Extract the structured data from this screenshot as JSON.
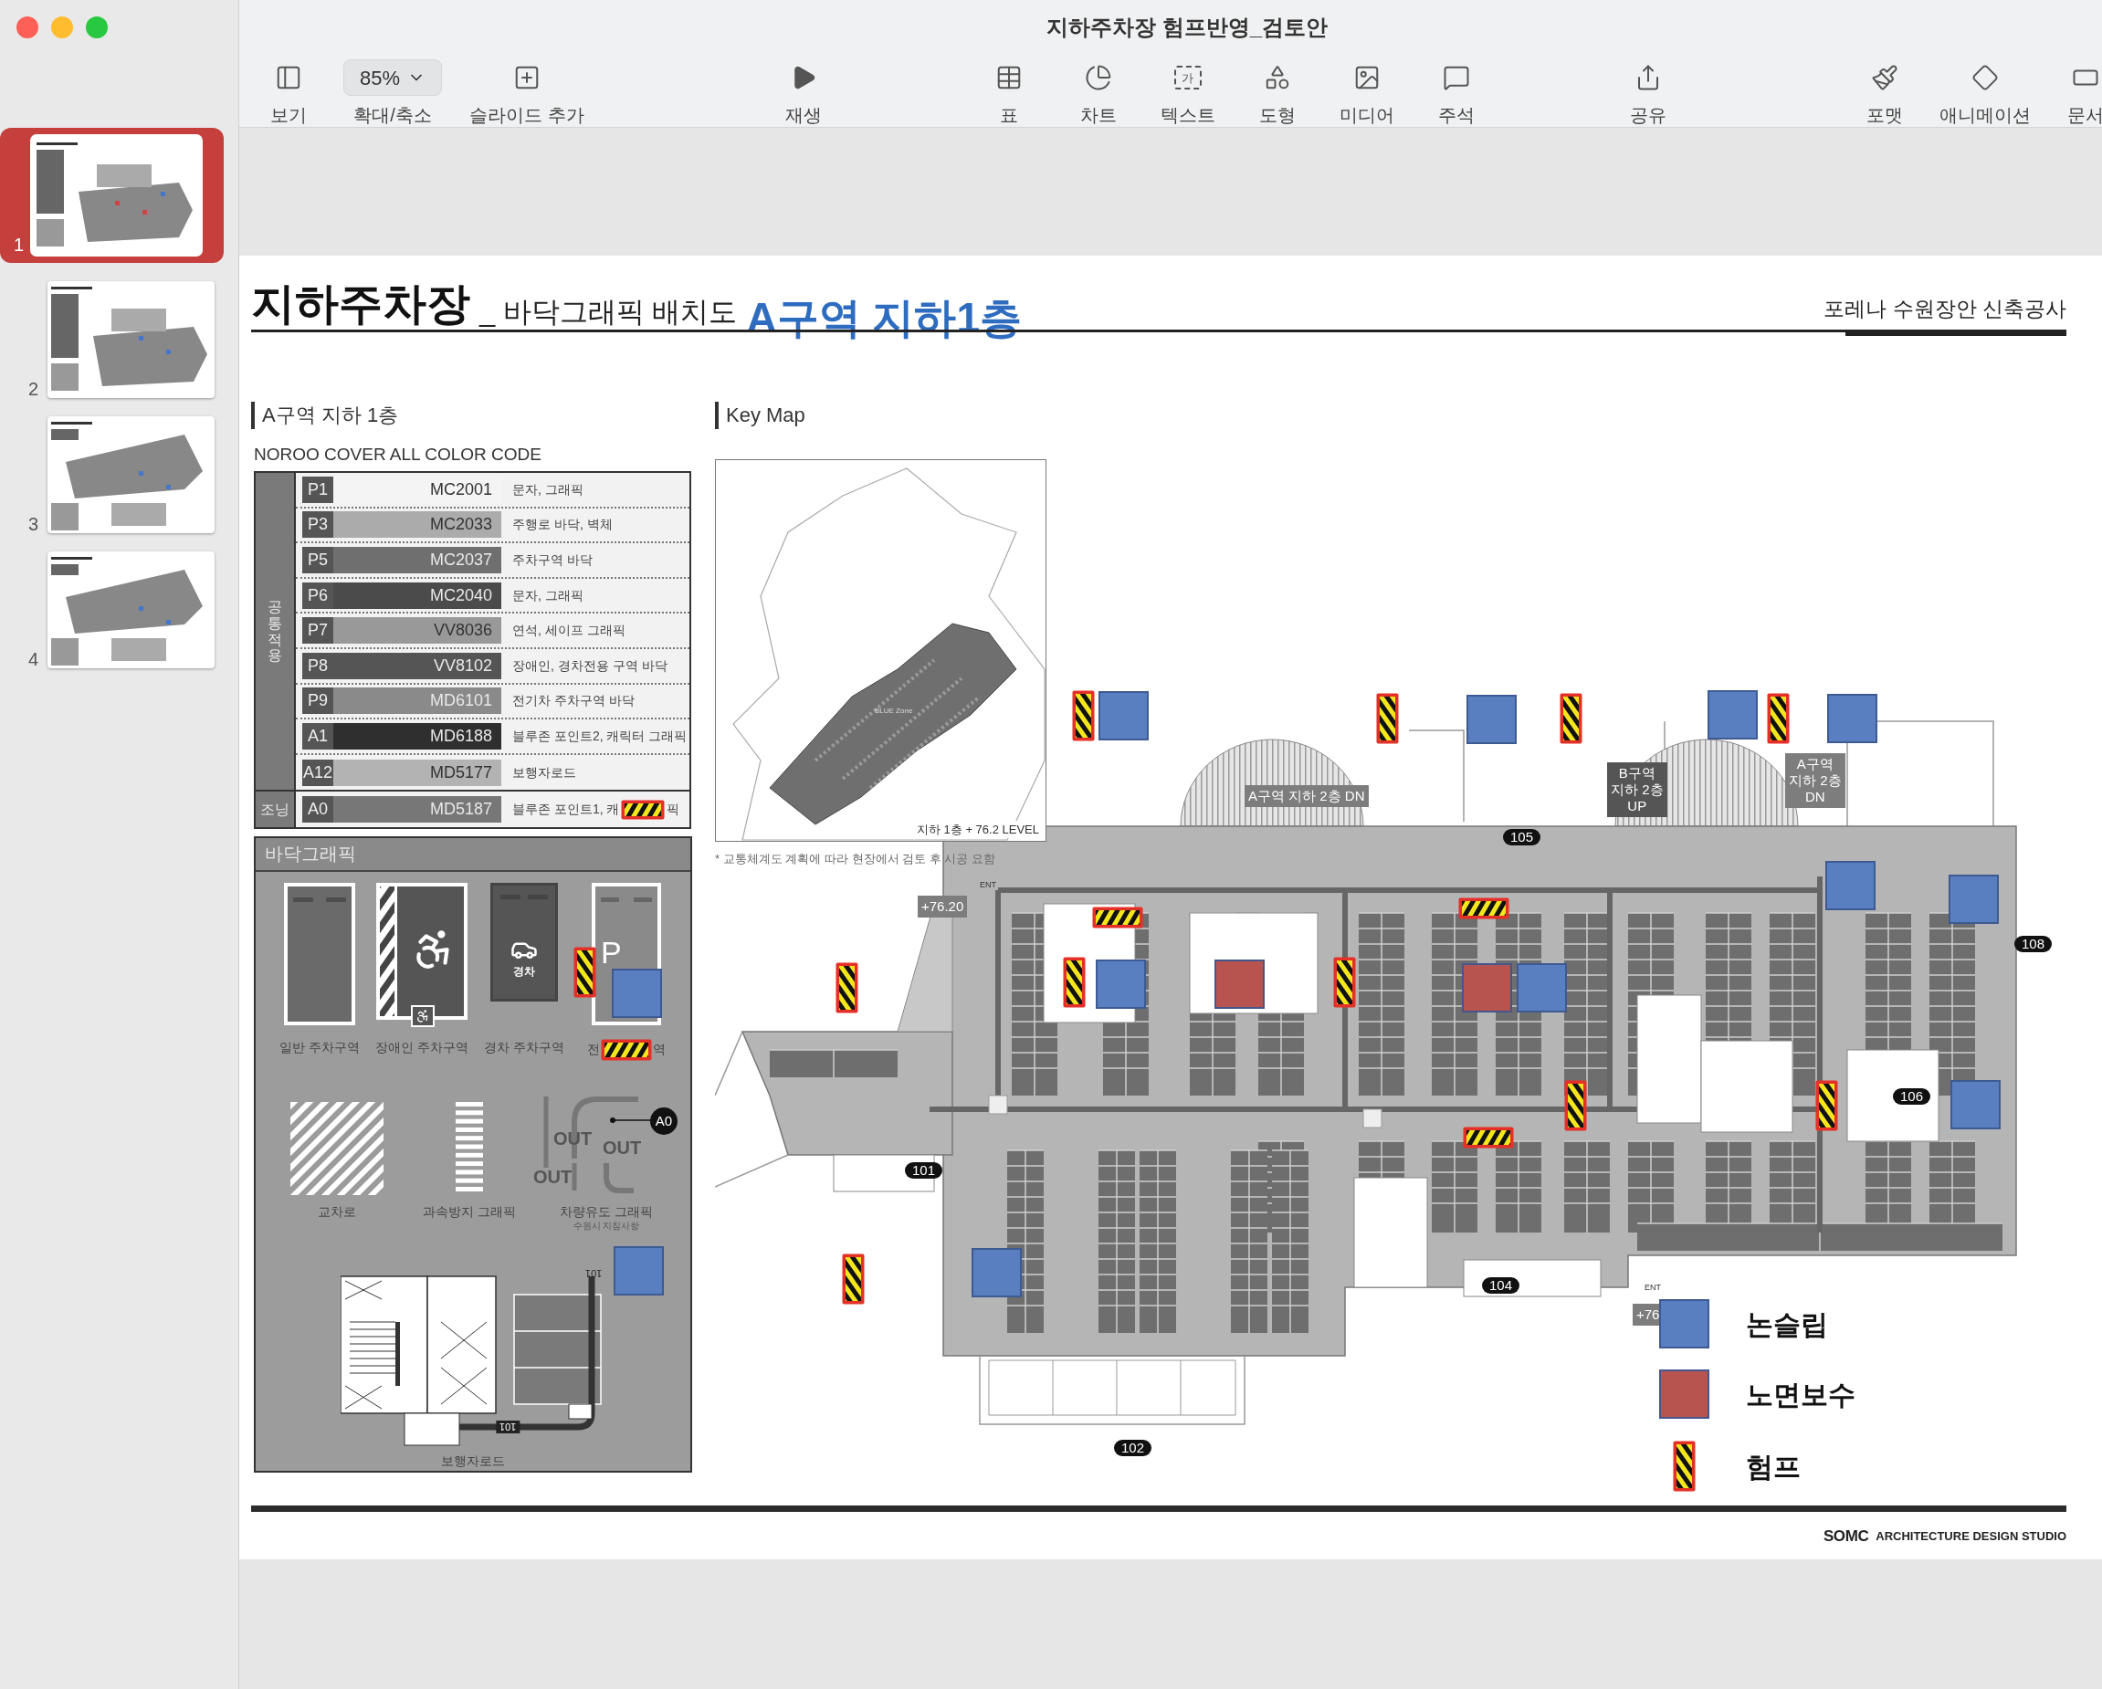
{
  "window": {
    "title": "지하주차장 험프반영_검토안"
  },
  "toolbar": [
    {
      "label": "보기",
      "kind": "view"
    },
    {
      "label": "확대/축소",
      "kind": "zoom",
      "value": "85%"
    },
    {
      "label": "슬라이드 추가",
      "kind": "add"
    },
    {
      "label": "재생",
      "kind": "play"
    },
    {
      "label": "표",
      "kind": "table"
    },
    {
      "label": "차트",
      "kind": "chart"
    },
    {
      "label": "텍스트",
      "kind": "text",
      "glyph": "가"
    },
    {
      "label": "도형",
      "kind": "shape"
    },
    {
      "label": "미디어",
      "kind": "media"
    },
    {
      "label": "주석",
      "kind": "comment"
    },
    {
      "label": "공유",
      "kind": "share"
    },
    {
      "label": "포맷",
      "kind": "format"
    },
    {
      "label": "애니메이션",
      "kind": "animate"
    },
    {
      "label": "문서",
      "kind": "document"
    }
  ],
  "slides": [
    {
      "number": "1",
      "selected": true
    },
    {
      "number": "2",
      "selected": false
    },
    {
      "number": "3",
      "selected": false
    },
    {
      "number": "4",
      "selected": false
    }
  ],
  "slide": {
    "title": "지하주차장",
    "subtitle": "_ 바닥그래픽 배치도",
    "overlay_title": "A구역 지하1층",
    "project": "포레나 수원장안 신축공사",
    "section_heading": "A구역 지하 1층",
    "color_code": {
      "title": "NOROO COVER ALL COLOR CODE",
      "groups": [
        {
          "label": "공통적용",
          "rows": [
            {
              "code": "P1",
              "name": "MC2001",
              "color": "#f4f4f4",
              "description": "문자, 그래픽"
            },
            {
              "code": "P3",
              "name": "MC2033",
              "color": "#ababab",
              "description": "주행로 바닥, 벽체"
            },
            {
              "code": "P5",
              "name": "MC2037",
              "color": "#6f6f6f",
              "description": "주차구역 바닥"
            },
            {
              "code": "P6",
              "name": "MC2040",
              "color": "#4b4b4b",
              "description": "문자, 그래픽"
            },
            {
              "code": "P7",
              "name": "VV8036",
              "color": "#999999",
              "description": "연석, 세이프 그래픽"
            },
            {
              "code": "P8",
              "name": "VV8102",
              "color": "#555555",
              "description": "장애인, 경차전용 구역 바닥"
            },
            {
              "code": "P9",
              "name": "MD6101",
              "color": "#8a8a8a",
              "description": "전기차 주차구역 바닥"
            },
            {
              "code": "A1",
              "name": "MD6188",
              "color": "#2f2f2f",
              "description": "블루존 포인트2, 캐릭터 그래픽"
            },
            {
              "code": "A12",
              "name": "MD5177",
              "color": "#b3b3b3",
              "description": "보행자로드"
            }
          ]
        },
        {
          "label": "조닝",
          "rows": [
            {
              "code": "A0",
              "name": "MD5187",
              "color": "#777777",
              "description": "블루존 포인트1, 캐",
              "hump": true,
              "description_tail": "픽"
            }
          ]
        }
      ]
    },
    "floor_graphics": {
      "title": "바닥그래픽",
      "parking": [
        {
          "kind": "general",
          "label": "일반 주차구역"
        },
        {
          "kind": "disabled",
          "label": "장애인 주차구역"
        },
        {
          "kind": "compact",
          "label": "경차 주차구역",
          "sign": "경차"
        },
        {
          "kind": "ev",
          "label": "전",
          "label_tail": "역",
          "sign": "P"
        }
      ],
      "markings": [
        {
          "kind": "crossing",
          "label": "교차로"
        },
        {
          "kind": "speed",
          "label": "과속방지 그래픽"
        },
        {
          "kind": "guide",
          "label": "차량유도 그래픽",
          "sublabel": "수원시 지침사항",
          "words": [
            "OUT",
            "OUT",
            "OUT"
          ],
          "badge": "A0"
        }
      ],
      "walkway": {
        "label": "보행자로드",
        "marks": [
          "101",
          "101"
        ]
      },
      "markers": [
        {
          "kind": "hump"
        },
        {
          "kind": "nonslip"
        },
        {
          "kind": "hump"
        },
        {
          "kind": "nonslip"
        }
      ]
    },
    "key_map": {
      "heading": "Key Map",
      "caption": "지하 1층 + 76.2 LEVEL",
      "zone_label": "BLUE Zone"
    },
    "note": "* 교통체계도 계획에 따라 현장에서 검토 후 시공 요함",
    "map": {
      "labels": [
        {
          "kind": "tag",
          "lines": [
            "A구역 지하 2층 DN"
          ]
        },
        {
          "kind": "pill",
          "lines": [
            "105"
          ]
        },
        {
          "kind": "dark",
          "lines": [
            "B구역",
            "지하 2층",
            "UP"
          ]
        },
        {
          "kind": "tag",
          "lines": [
            "A구역",
            "지하 2층",
            "DN"
          ]
        },
        {
          "kind": "tag",
          "lines": [
            "+76.20"
          ]
        },
        {
          "kind": "pill",
          "lines": [
            "108"
          ]
        },
        {
          "kind": "pill",
          "lines": [
            "101"
          ]
        },
        {
          "kind": "pill",
          "lines": [
            "106"
          ]
        },
        {
          "kind": "pill",
          "lines": [
            "104"
          ]
        },
        {
          "kind": "pill",
          "lines": [
            "102"
          ]
        },
        {
          "kind": "tag",
          "lines": [
            "+76"
          ]
        },
        {
          "kind": "ent",
          "lines": [
            "ENT"
          ]
        },
        {
          "kind": "ent",
          "lines": [
            "ENT"
          ]
        }
      ],
      "markers": [
        {
          "kind": "hump"
        },
        {
          "kind": "nonslip"
        },
        {
          "kind": "hump"
        },
        {
          "kind": "nonslip"
        },
        {
          "kind": "hump"
        },
        {
          "kind": "nonslip"
        },
        {
          "kind": "hump"
        },
        {
          "kind": "nonslip"
        },
        {
          "kind": "hump"
        },
        {
          "kind": "hump"
        },
        {
          "kind": "nonslip"
        },
        {
          "kind": "nonslip"
        },
        {
          "kind": "hump"
        },
        {
          "kind": "hump"
        },
        {
          "kind": "nonslip"
        },
        {
          "kind": "repair"
        },
        {
          "kind": "hump"
        },
        {
          "kind": "repair"
        },
        {
          "kind": "nonslip"
        },
        {
          "kind": "hump"
        },
        {
          "kind": "hump"
        },
        {
          "kind": "hump"
        },
        {
          "kind": "nonslip"
        },
        {
          "kind": "hump"
        },
        {
          "kind": "nonslip"
        }
      ]
    },
    "legend": [
      {
        "kind": "nonslip",
        "label": "논슬립"
      },
      {
        "kind": "repair",
        "label": "노면보수"
      },
      {
        "kind": "hump",
        "label": "험프"
      }
    ],
    "footer": {
      "logo": "SOMC",
      "studio": "ARCHITECTURE DESIGN STUDIO"
    }
  }
}
